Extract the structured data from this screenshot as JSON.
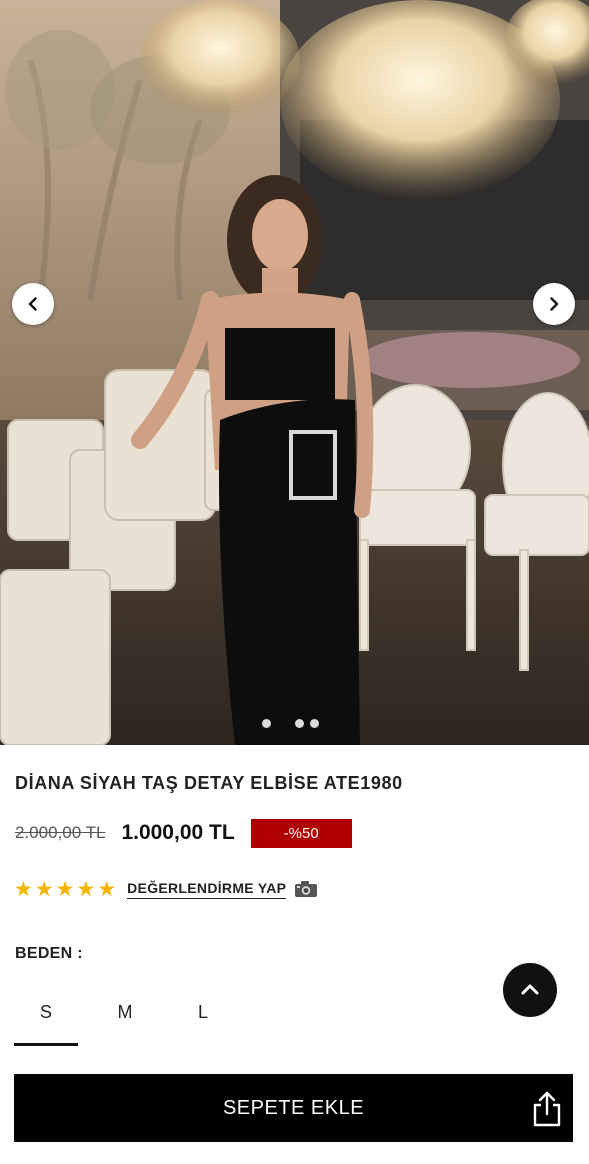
{
  "product": {
    "title": "DİANA SİYAH TAŞ DETAY ELBİSE ATE1980",
    "old_price": "2.000,00 TL",
    "new_price": "1.000,00 TL",
    "discount": "-%50",
    "rating": 5,
    "review_link": "DEĞERLENDİRME YAP"
  },
  "gallery": {
    "prev_icon": "chevron-left-icon",
    "next_icon": "chevron-right-icon",
    "image_count": 3,
    "active_image": 1
  },
  "sizes": {
    "label": "BEDEN :",
    "options": [
      "S",
      "M",
      "L"
    ],
    "selected": "S"
  },
  "actions": {
    "add_to_cart": "SEPETE EKLE",
    "share_icon": "share-icon",
    "scroll_top_icon": "chevron-up-icon"
  },
  "colors": {
    "discount_bg": "#b00000",
    "star": "#f5b400",
    "cart_bg": "#000000"
  }
}
